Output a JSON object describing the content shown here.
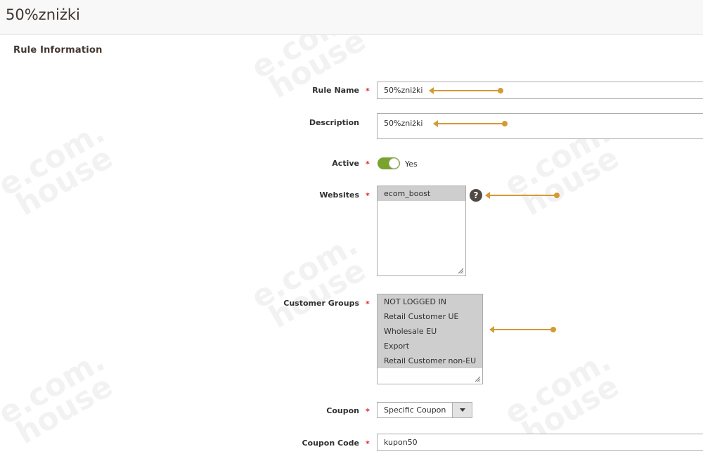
{
  "page": {
    "title": "50%zniżki"
  },
  "section": {
    "title": "Rule Information"
  },
  "form": {
    "rule_name": {
      "label": "Rule Name",
      "value": "50%zniżki"
    },
    "description": {
      "label": "Description",
      "value": "50%zniżki"
    },
    "active": {
      "label": "Active",
      "value_text": "Yes",
      "on": true
    },
    "websites": {
      "label": "Websites",
      "options": [
        "ecom_boost"
      ],
      "help": "?"
    },
    "customer_groups": {
      "label": "Customer Groups",
      "options": [
        "NOT LOGGED IN",
        "Retail Customer UE",
        "Wholesale EU",
        "Export",
        "Retail Customer non-EU"
      ]
    },
    "coupon": {
      "label": "Coupon",
      "value": "Specific Coupon"
    },
    "coupon_code": {
      "label": "Coupon Code",
      "value": "kupon50"
    },
    "required_mark": "*"
  },
  "watermark": {
    "line1": "e.com.",
    "line2": "house"
  },
  "colors": {
    "annotation": "#d49a34",
    "toggle_on": "#79a22e",
    "required": "#e22626"
  }
}
